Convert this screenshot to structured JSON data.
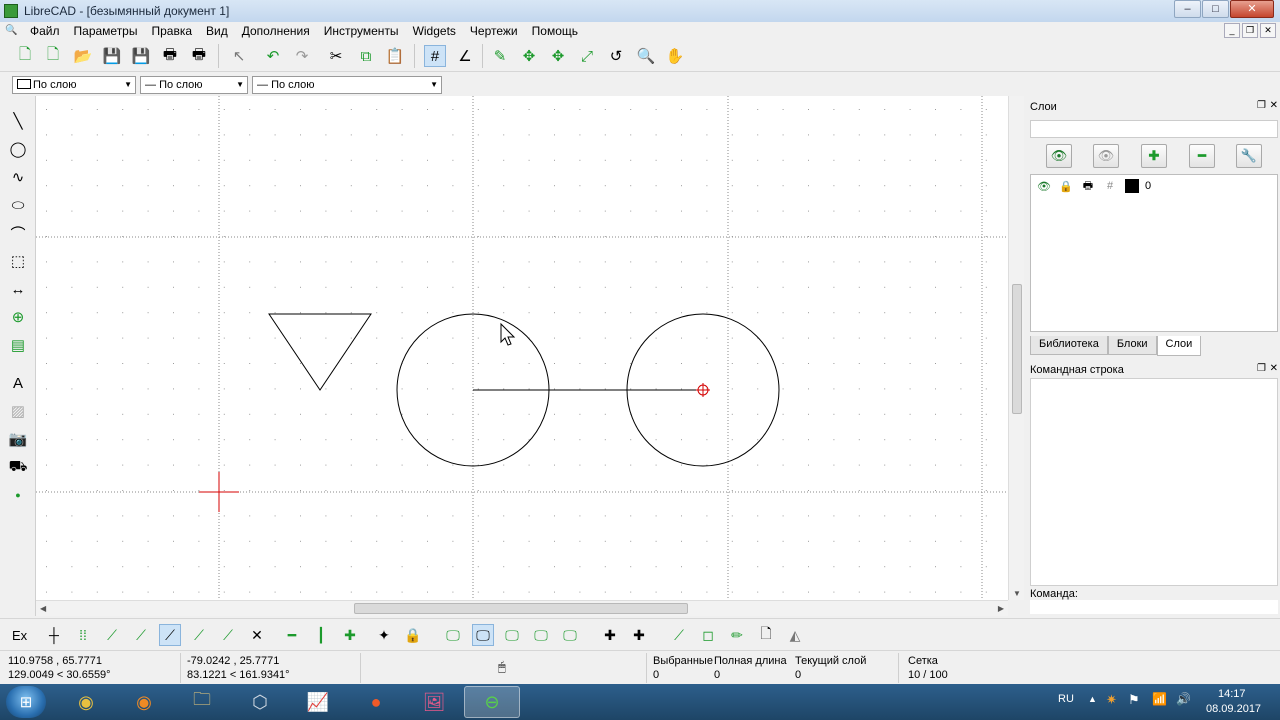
{
  "window": {
    "title": "LibreCAD - [безымянный документ 1]",
    "controls": [
      "–",
      "□",
      "✕"
    ]
  },
  "menu": {
    "items": [
      "Файл",
      "Параметры",
      "Правка",
      "Вид",
      "Дополнения",
      "Инструменты",
      "Widgets",
      "Чертежи",
      "Помощь"
    ]
  },
  "toolbar": {
    "buttons": [
      "new-icon",
      "new-template-icon",
      "open-icon",
      "save-icon",
      "save-as-icon",
      "print-icon",
      "print-preview-icon",
      "select-pointer-icon",
      "undo-icon",
      "redo-icon",
      "cut-icon",
      "copy-icon",
      "paste-icon",
      "grid-icon",
      "draft-icon",
      "redraw-icon",
      "zoom-in-icon",
      "zoom-out-icon",
      "zoom-auto-icon",
      "zoom-previous-icon",
      "zoom-window-icon",
      "zoom-pan-icon"
    ]
  },
  "properties": {
    "color": "По слою",
    "width": "По слою",
    "linetype": "По слою"
  },
  "layers_dock": {
    "title": "Слои",
    "layer_name": "0",
    "layer_color": "#000000"
  },
  "tabs": {
    "library": "Библиотека",
    "blocks": "Блоки",
    "layers": "Слои"
  },
  "command_dock": {
    "title": "Командная строка",
    "prompt": "Команда:"
  },
  "snapbar": {
    "ex_label": "Ex"
  },
  "status": {
    "abs_xy": "110.9758 , 65.7771",
    "abs_polar": "129.0049 < 30.6559°",
    "rel_xy": "-79.0242 , 25.7771",
    "rel_polar": "83.1221 < 161.9341°",
    "selected_label": "Выбранные",
    "selected_value": "0",
    "total_length_label": "Полная длина",
    "total_length_value": "0",
    "current_layer_label": "Текущий слой",
    "current_layer_value": "0",
    "grid_label": "Сетка",
    "grid_value": "10 / 100"
  },
  "taskbar": {
    "lang": "RU",
    "time": "14:17",
    "date": "08.09.2017"
  },
  "colors": {
    "selected_center_marker": "#d40000",
    "cursor": "#d40000"
  }
}
